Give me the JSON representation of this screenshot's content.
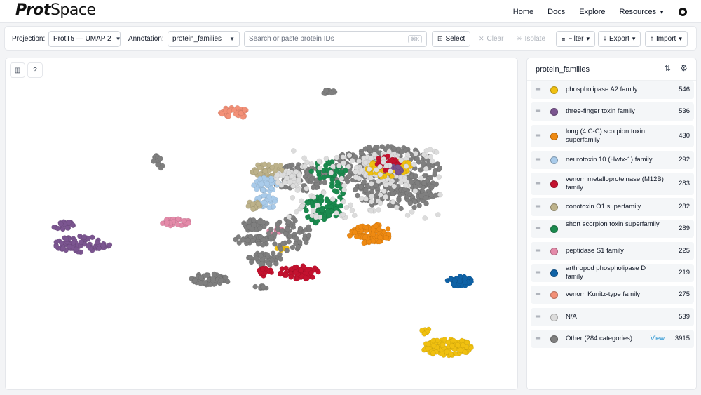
{
  "app": {
    "logo_bold": "Prot",
    "logo_rest": "Space"
  },
  "nav": {
    "home": "Home",
    "docs": "Docs",
    "explore": "Explore",
    "resources": "Resources",
    "github_icon": "github-icon"
  },
  "toolbar": {
    "projection_label": "Projection:",
    "projection_value": "ProtT5 — UMAP 2",
    "annotation_label": "Annotation:",
    "annotation_value": "protein_families",
    "search_placeholder": "Search or paste protein IDs",
    "search_shortcut": "⌘K",
    "select_label": "Select",
    "clear_label": "Clear",
    "isolate_label": "Isolate",
    "filter_label": "Filter",
    "export_label": "Export",
    "import_label": "Import"
  },
  "legend": {
    "title": "protein_families",
    "items": [
      {
        "label": "phospholipase A2 family",
        "count": "546",
        "color": "#f0c010"
      },
      {
        "label": "three-finger toxin family",
        "count": "536",
        "color": "#7b5590"
      },
      {
        "label": "long (4 C-C) scorpion toxin superfamily",
        "count": "430",
        "color": "#ef8a12"
      },
      {
        "label": "neurotoxin 10 (Hwtx-1) family",
        "count": "292",
        "color": "#a9cbea"
      },
      {
        "label": "venom metalloproteinase (M12B) family",
        "count": "283",
        "color": "#c4122f"
      },
      {
        "label": "conotoxin O1 superfamily",
        "count": "282",
        "color": "#bdb28a"
      },
      {
        "label": "short scorpion toxin superfamily",
        "count": "289",
        "color": "#1a8a4e"
      },
      {
        "label": "peptidase S1 family",
        "count": "225",
        "color": "#e48aa9"
      },
      {
        "label": "arthropod phospholipase D family",
        "count": "219",
        "color": "#0f62a6"
      },
      {
        "label": "venom Kunitz-type family",
        "count": "275",
        "color": "#f39077"
      },
      {
        "label": "N/A",
        "count": "539",
        "color": "#dcdcdc"
      },
      {
        "label": "Other (284 categories)",
        "count": "3915",
        "color": "#7f7f7f",
        "view": "View"
      }
    ]
  }
}
